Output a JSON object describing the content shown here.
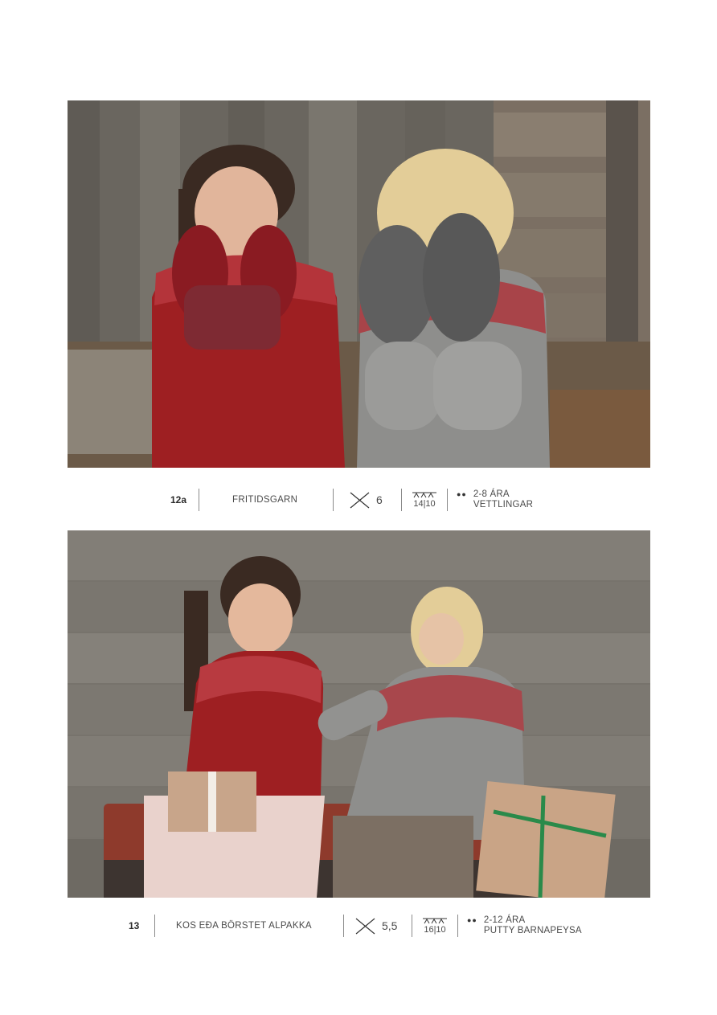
{
  "patterns": [
    {
      "code": "12a",
      "yarn": "FRITIDSGARN",
      "needle_size": "6",
      "gauge": "14|10",
      "sizes": "2-8 ÁRA",
      "item": "VETTLINGAR"
    },
    {
      "code": "13",
      "yarn": "KOS EÐA BÖRSTET ALPAKKA",
      "needle_size": "5,5",
      "gauge": "16|10",
      "sizes": "2-12 ÁRA",
      "item": "PUTTY BARNAPEYSA"
    }
  ],
  "icons": {
    "needles": "crossed-needles-icon",
    "gauge": "knit-gauge-icon",
    "sizes": "size-dots-icon"
  },
  "colors": {
    "red_sweater": "#9e1f22",
    "grey_sweater": "#8e8e8c",
    "wood": "#6b6760"
  }
}
